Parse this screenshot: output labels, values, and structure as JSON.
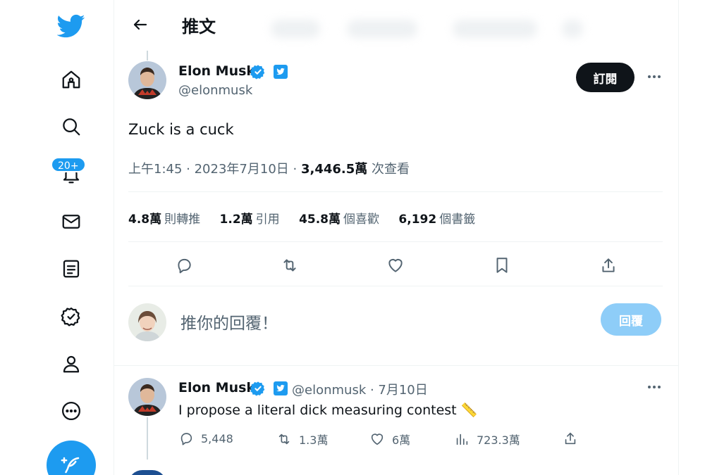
{
  "header": {
    "title": "推文"
  },
  "sidebar": {
    "items": [
      {
        "icon": "home-icon"
      },
      {
        "icon": "search-icon"
      },
      {
        "icon": "bell-icon",
        "badge": "20+"
      },
      {
        "icon": "mail-icon"
      },
      {
        "icon": "list-icon"
      },
      {
        "icon": "verified-icon"
      },
      {
        "icon": "profile-icon"
      },
      {
        "icon": "more-circle-icon"
      }
    ],
    "compose_icon": "compose-feather-icon"
  },
  "tweet": {
    "author_name": "Elon Musk",
    "handle": "@elonmusk",
    "subscribe_label": "訂閱",
    "text": "Zuck is a cuck",
    "time": "上午1:45",
    "date": "2023年7月10日",
    "views_count": "3,446.5萬",
    "views_label": "次查看",
    "stats": [
      {
        "value": "4.8萬",
        "label": "則轉推"
      },
      {
        "value": "1.2萬",
        "label": "引用"
      },
      {
        "value": "45.8萬",
        "label": "個喜歡"
      },
      {
        "value": "6,192",
        "label": "個書籤"
      }
    ]
  },
  "compose_reply": {
    "placeholder": "推你的回覆！",
    "button_label": "回覆"
  },
  "reply": {
    "author_name": "Elon Musk",
    "handle_date": "@elonmusk · 7月10日",
    "text": "I propose a literal dick measuring contest 📏",
    "replies": "5,448",
    "retweets": "1.3萬",
    "likes": "6萬",
    "views": "723.3萬"
  },
  "colors": {
    "accent": "#1d9bf0",
    "text": "#0f1419",
    "secondary": "#536471",
    "reply_button_disabled": "#8ecdf8"
  }
}
